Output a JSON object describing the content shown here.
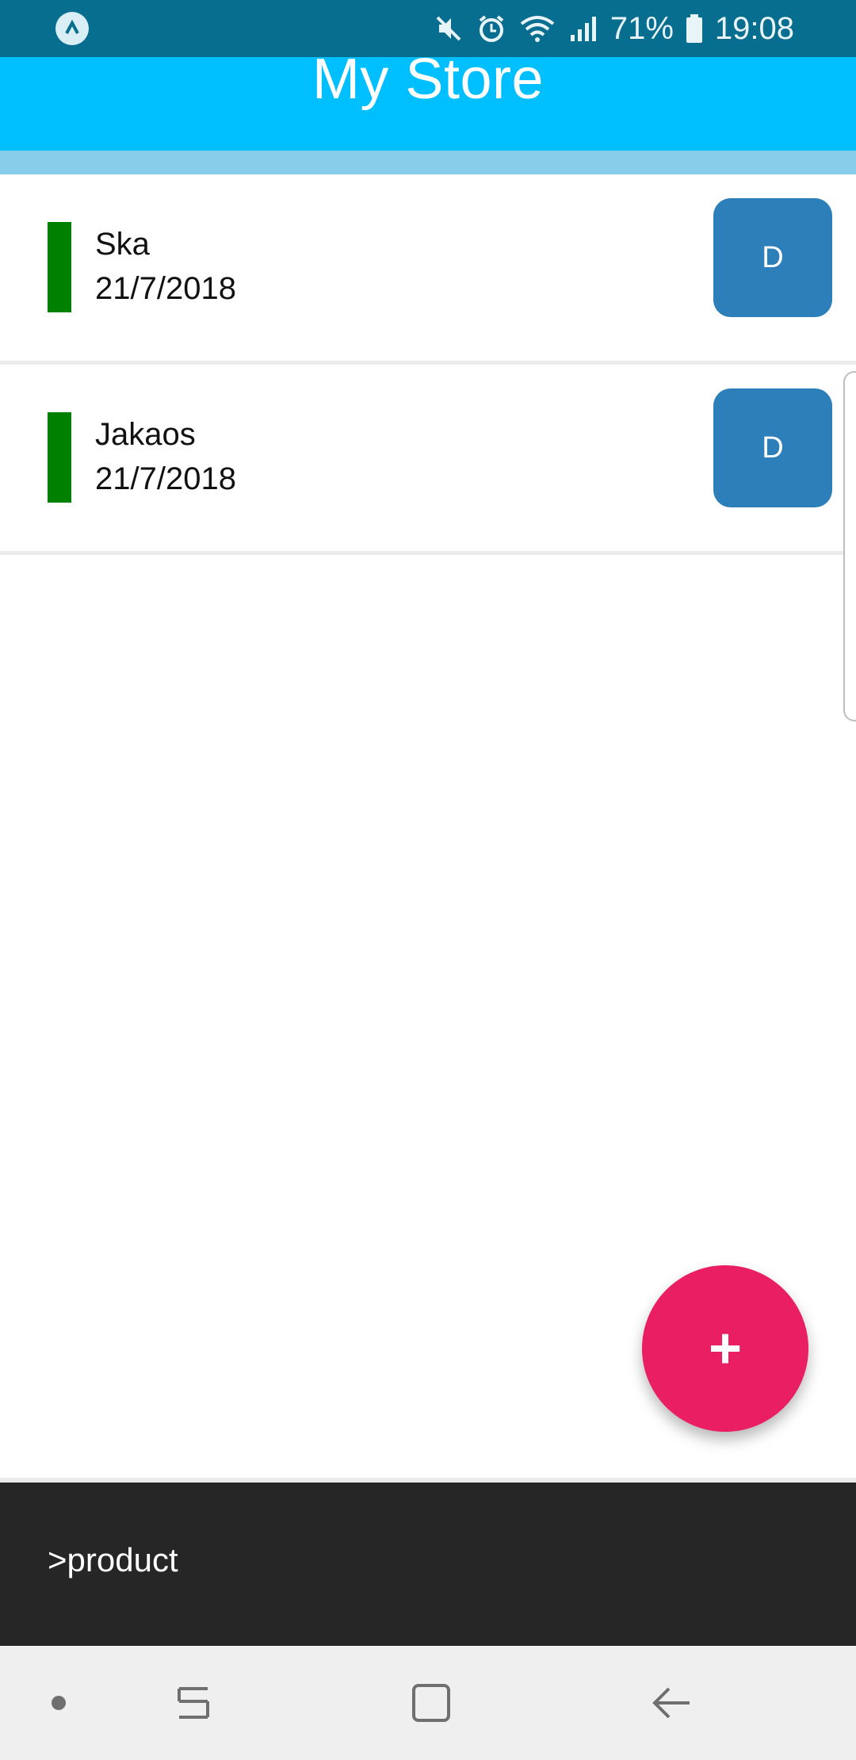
{
  "status_bar": {
    "app_icon": "caret-up-icon",
    "icons": [
      "mute-icon",
      "alarm-icon",
      "wifi-icon",
      "signal-icon"
    ],
    "battery_percent": "71%",
    "battery_icon": "battery-icon",
    "time": "19:08",
    "colors": {
      "background": "#086e8f"
    }
  },
  "header": {
    "title": "My Store",
    "colors": {
      "background": "#00bfff",
      "strip": "#87ceeb"
    }
  },
  "list": {
    "items": [
      {
        "name": "Ska",
        "date": "21/7/2018",
        "button_label": "D",
        "indicator_color": "#008000"
      },
      {
        "name": "Jakaos",
        "date": "21/7/2018",
        "button_label": "D",
        "indicator_color": "#008000"
      }
    ],
    "button_color": "#2c7fb8"
  },
  "fab": {
    "label": "+",
    "icon": "plus-icon",
    "color": "#e91e63"
  },
  "console": {
    "text": ">product",
    "background": "#262626"
  },
  "nav_bar": {
    "buttons": [
      "dot-icon",
      "recent-apps-icon",
      "home-icon",
      "back-icon"
    ]
  }
}
